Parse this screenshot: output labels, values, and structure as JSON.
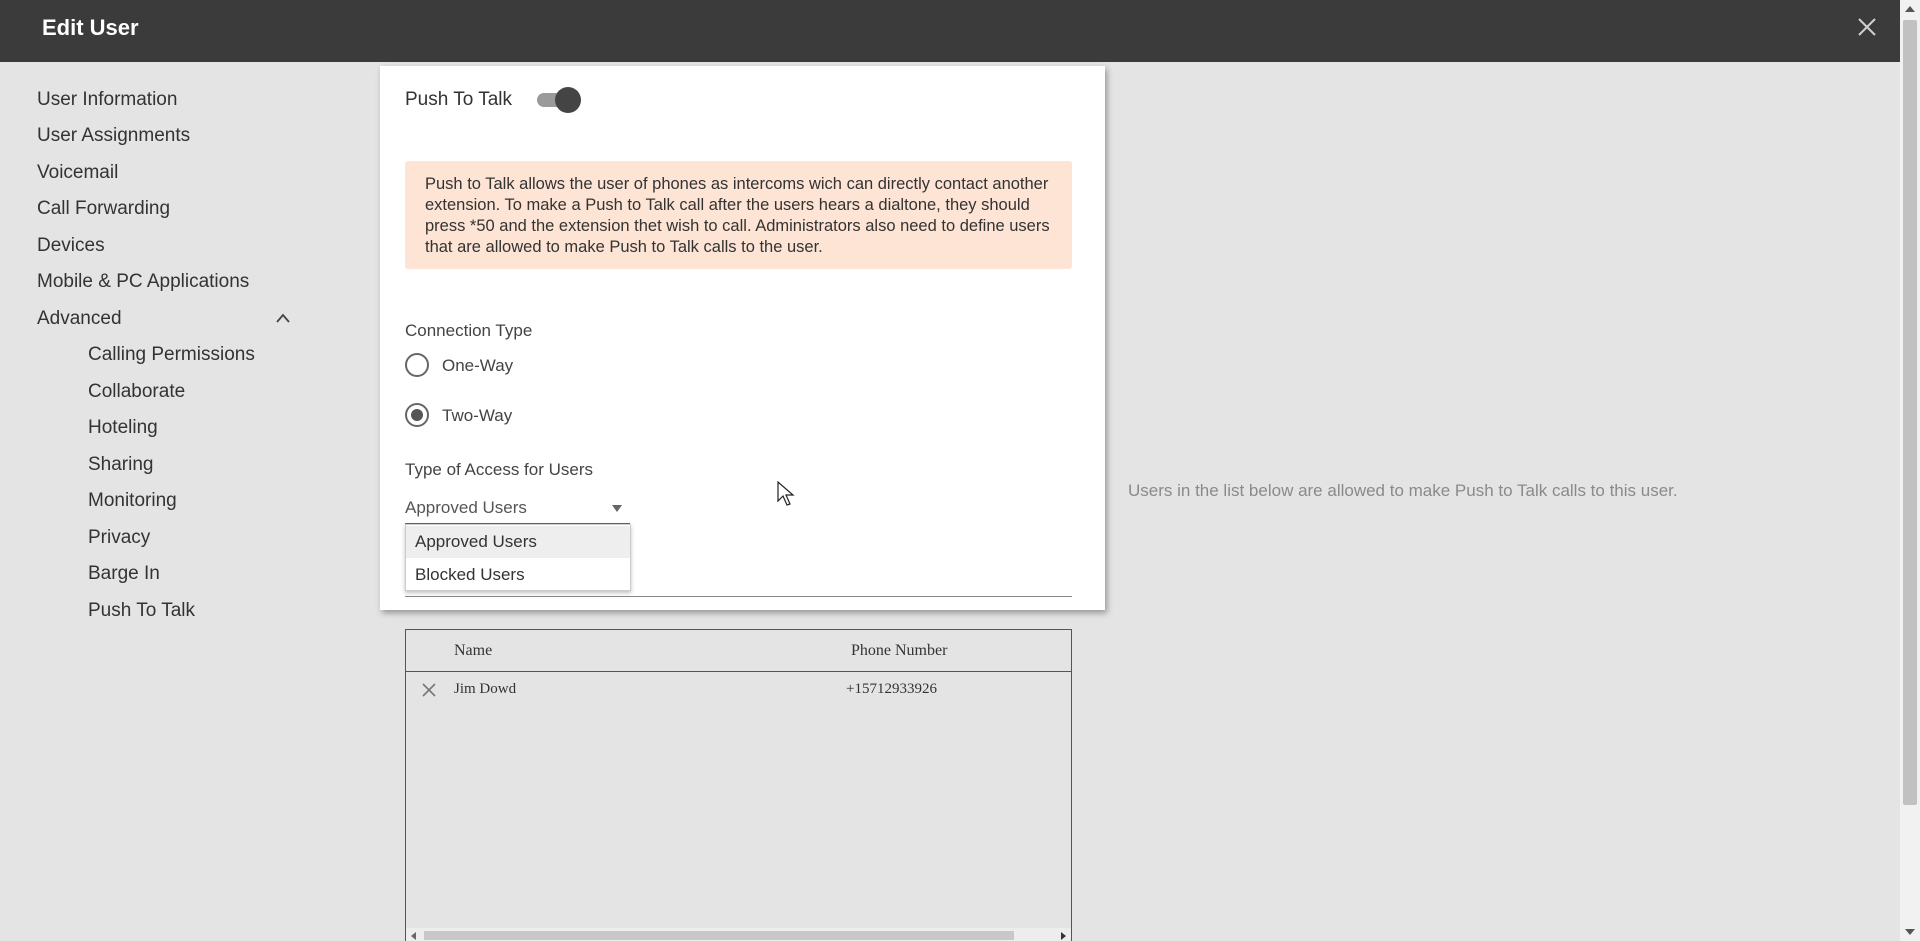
{
  "header": {
    "title": "Edit User",
    "close_icon": "close-icon"
  },
  "sidebar": {
    "items": [
      {
        "label": "User Information"
      },
      {
        "label": "User Assignments"
      },
      {
        "label": "Voicemail"
      },
      {
        "label": "Call Forwarding"
      },
      {
        "label": "Devices"
      },
      {
        "label": "Mobile & PC Applications"
      },
      {
        "label": "Advanced",
        "expanded": true
      }
    ],
    "advanced_items": [
      {
        "label": "Calling Permissions"
      },
      {
        "label": "Collaborate"
      },
      {
        "label": "Hoteling"
      },
      {
        "label": "Sharing"
      },
      {
        "label": "Monitoring"
      },
      {
        "label": "Privacy"
      },
      {
        "label": "Barge In"
      },
      {
        "label": "Push To Talk"
      }
    ]
  },
  "push_to_talk": {
    "label": "Push To Talk",
    "enabled": true,
    "notice": "Push to Talk allows the user of phones as intercoms wich can directly contact another extension. To make a Push to Talk call after the users hears a dialtone, they should press *50 and the extension thet wish to call. Administrators also need to define users that are allowed to make Push to Talk calls to the user.",
    "notice_color": "#fde4d4"
  },
  "connection_type": {
    "label": "Connection Type",
    "options": [
      {
        "label": "One-Way",
        "checked": false
      },
      {
        "label": "Two-Way",
        "checked": true
      }
    ]
  },
  "access_type": {
    "label": "Type of Access for Users",
    "selected": "Approved Users",
    "options": [
      {
        "label": "Approved Users"
      },
      {
        "label": "Blocked Users"
      }
    ]
  },
  "info_text": "Users in the list below are allowed to make Push to Talk calls to this user.",
  "users_table": {
    "columns": [
      "Name",
      "Phone Number"
    ],
    "rows": [
      {
        "name": "Jim Dowd",
        "phone": "+15712933926"
      }
    ]
  },
  "colors": {
    "topbar": "#3b3b3b",
    "background": "#e4e4e4",
    "card": "#ffffff"
  }
}
